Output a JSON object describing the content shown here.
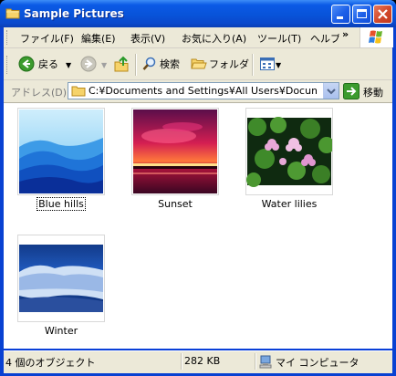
{
  "window": {
    "title": "Sample Pictures"
  },
  "menu": {
    "items": [
      "ファイル(F)",
      "編集(E)",
      "表示(V)",
      "お気に入り(A)",
      "ツール(T)",
      "ヘルプ"
    ],
    "chevron": "»"
  },
  "toolbar": {
    "back_label": "戻る",
    "search_label": "検索",
    "folders_label": "フォルダ"
  },
  "address": {
    "label": "アドレス(D)",
    "value": "C:¥Documents and Settings¥All Users¥Documents¥My Pictures¥Sample Pictures",
    "go_label": "移動"
  },
  "files": [
    {
      "name": "Blue hills",
      "selected": true
    },
    {
      "name": "Sunset",
      "selected": false
    },
    {
      "name": "Water lilies",
      "selected": false
    },
    {
      "name": "Winter",
      "selected": false
    }
  ],
  "status": {
    "count": "4 個のオブジェクト",
    "size": "282 KB",
    "location": "マイ コンピュータ"
  },
  "colors": {
    "title_bar": "#0853d9",
    "chrome": "#ece9d8",
    "close_button": "#d1472a"
  }
}
